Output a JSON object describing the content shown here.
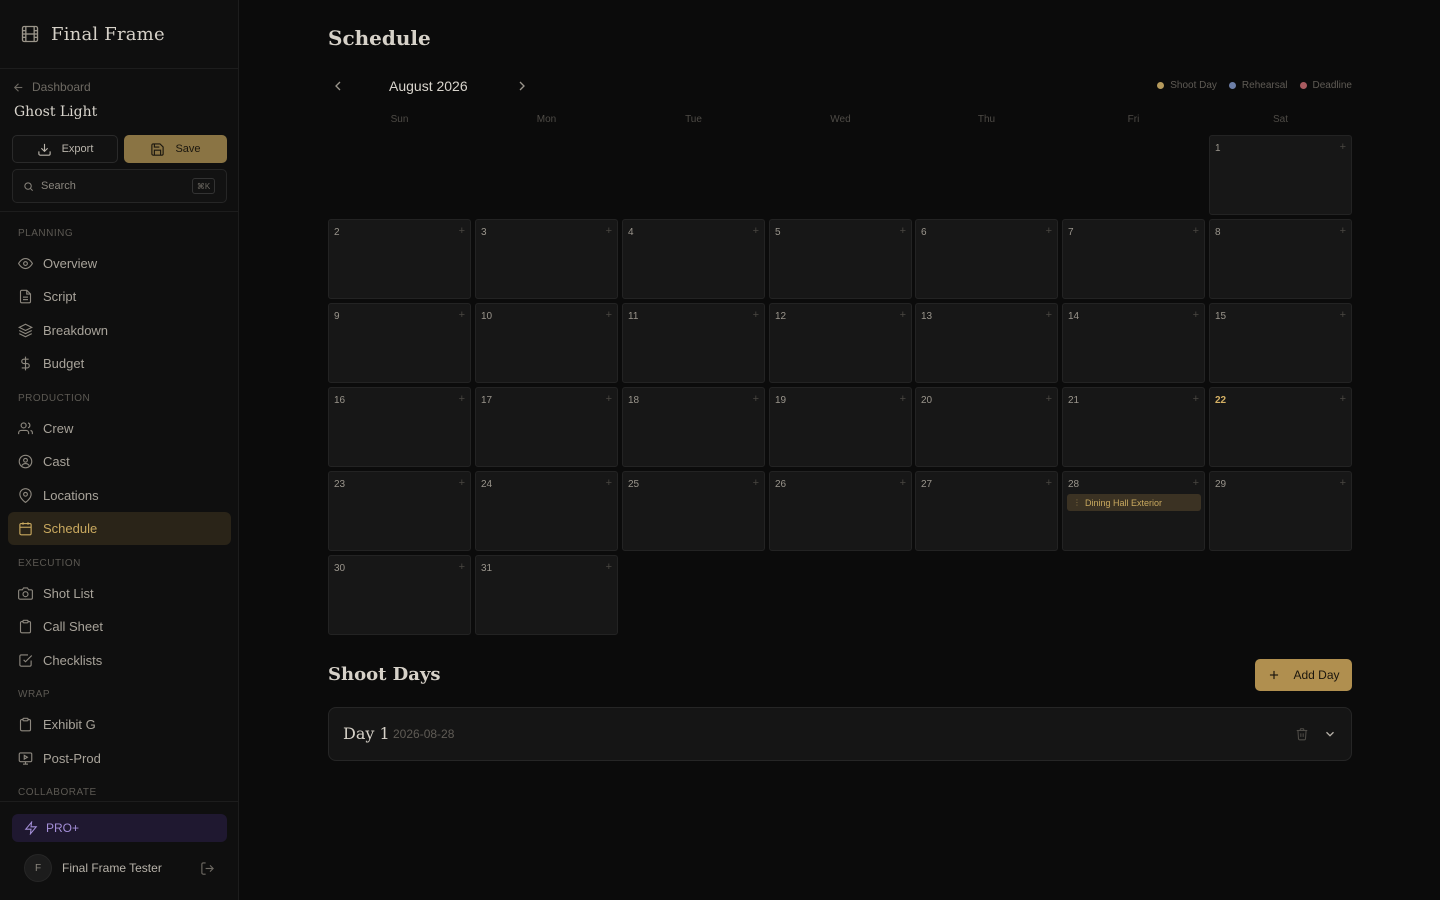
{
  "brand": {
    "title": "Final Frame"
  },
  "sidebar": {
    "back_label": "Dashboard",
    "project_name": "Ghost Light",
    "export_label": "Export",
    "save_label": "Save",
    "search_placeholder": "Search",
    "search_shortcut": "⌘K",
    "sections": [
      {
        "label": "PLANNING",
        "items": [
          {
            "label": "Overview",
            "icon": "eye-icon"
          },
          {
            "label": "Script",
            "icon": "document-icon"
          },
          {
            "label": "Breakdown",
            "icon": "layers-icon"
          },
          {
            "label": "Budget",
            "icon": "dollar-icon"
          }
        ]
      },
      {
        "label": "PRODUCTION",
        "items": [
          {
            "label": "Crew",
            "icon": "users-icon"
          },
          {
            "label": "Cast",
            "icon": "user-circle-icon"
          },
          {
            "label": "Locations",
            "icon": "map-pin-icon"
          },
          {
            "label": "Schedule",
            "icon": "calendar-icon",
            "active": true
          }
        ]
      },
      {
        "label": "EXECUTION",
        "items": [
          {
            "label": "Shot List",
            "icon": "camera-icon"
          },
          {
            "label": "Call Sheet",
            "icon": "clipboard-icon"
          },
          {
            "label": "Checklists",
            "icon": "checkbox-icon"
          }
        ]
      },
      {
        "label": "WRAP",
        "items": [
          {
            "label": "Exhibit G",
            "icon": "clipboard-icon"
          },
          {
            "label": "Post-Prod",
            "icon": "monitor-icon"
          }
        ]
      },
      {
        "label": "COLLABORATE",
        "items": []
      }
    ],
    "pro_label": "PRO+",
    "user": {
      "initial": "F",
      "name": "Final Frame Tester"
    }
  },
  "schedule": {
    "title": "Schedule",
    "month_label": "August 2026",
    "legend": [
      {
        "label": "Shoot Day",
        "color": "#b59a5c"
      },
      {
        "label": "Rehearsal",
        "color": "#6d7fa8"
      },
      {
        "label": "Deadline",
        "color": "#a85a5f"
      }
    ],
    "weekdays": [
      "Sun",
      "Mon",
      "Tue",
      "Wed",
      "Thu",
      "Fri",
      "Sat"
    ],
    "first_weekday": 6,
    "days_in_month": 31,
    "today": 22,
    "events": [
      {
        "day": 28,
        "label": "Dining Hall Exterior",
        "type": "Shoot Day"
      }
    ],
    "add_glyph": "+"
  },
  "shoot_days": {
    "title": "Shoot Days",
    "add_label": "Add Day",
    "items": [
      {
        "title": "Day 1",
        "date": "2026-08-28"
      }
    ]
  },
  "colors": {
    "accent": "#b08f4f",
    "active_nav_bg": "#2a2418",
    "pro_bg": "#1f1830"
  }
}
